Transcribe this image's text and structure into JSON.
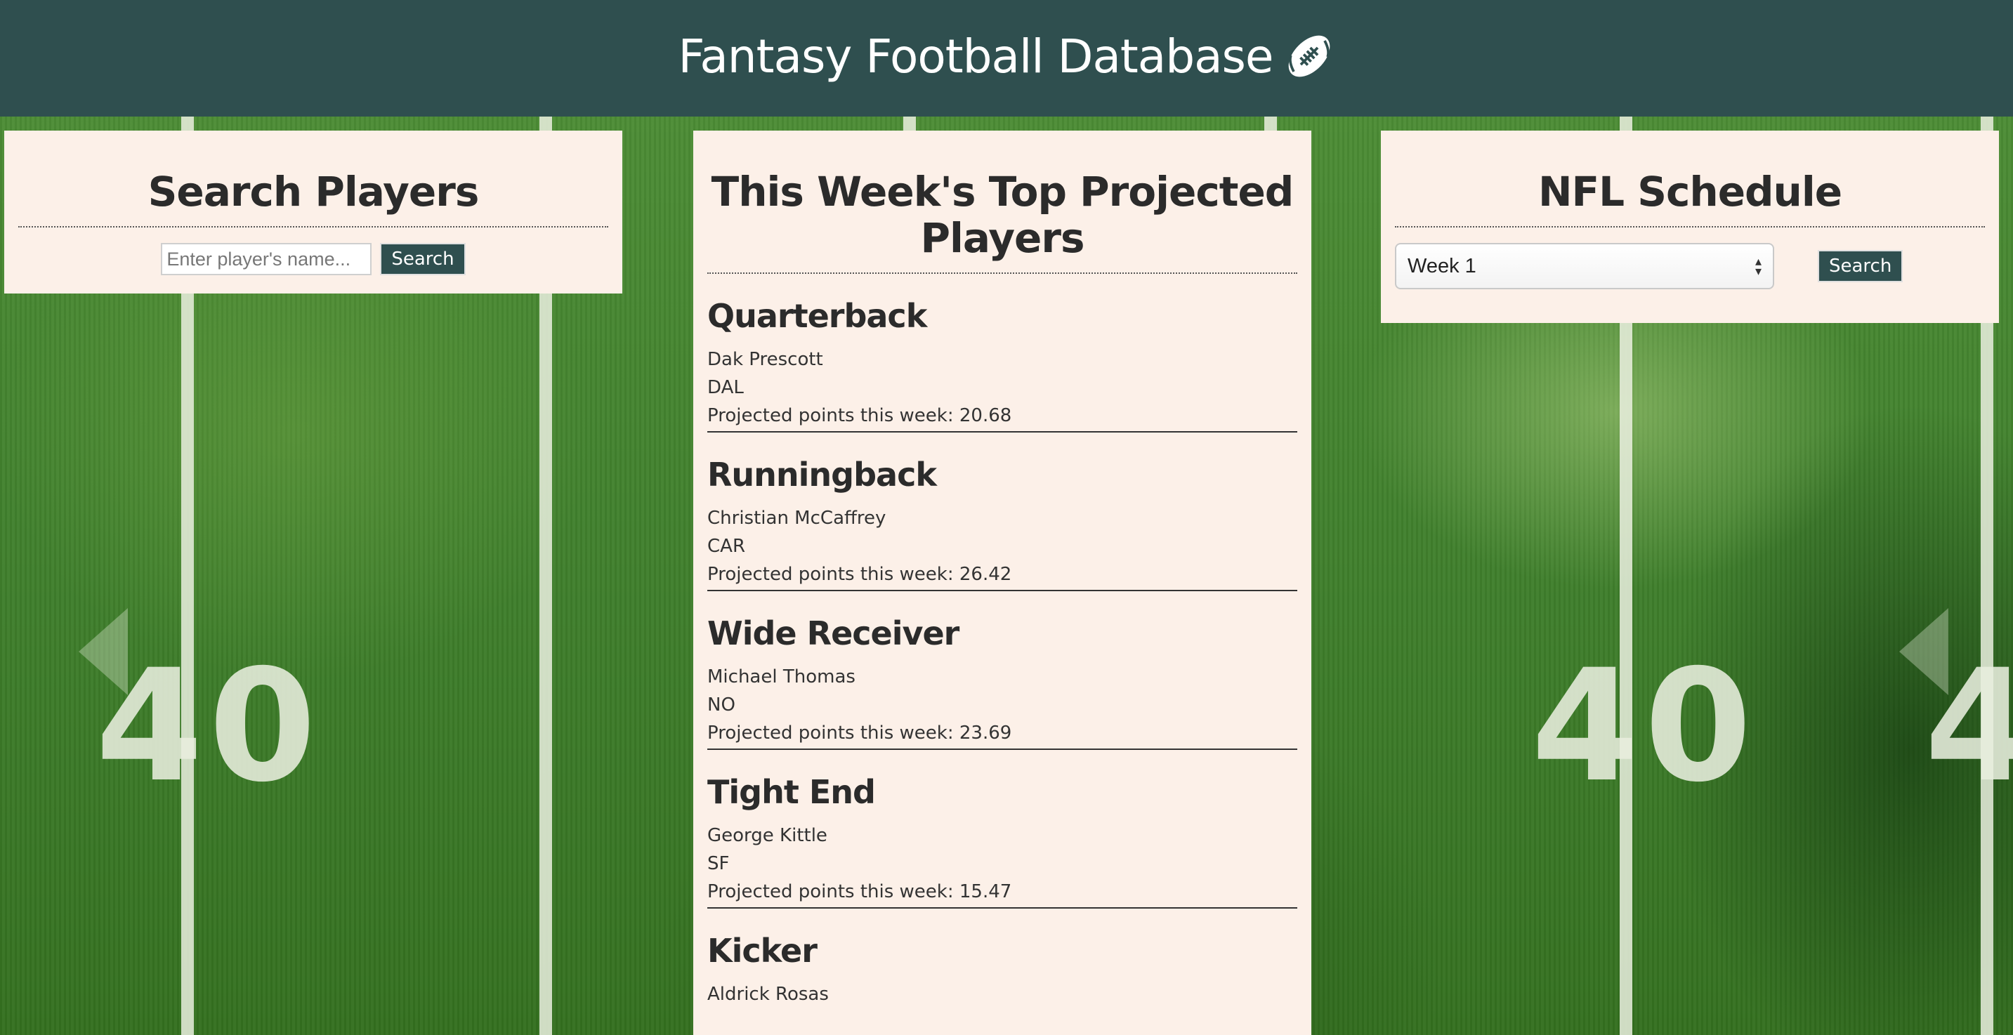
{
  "header": {
    "title": "Fantasy Football Database"
  },
  "search_panel": {
    "title": "Search Players",
    "input_placeholder": "Enter player's name...",
    "button_label": "Search"
  },
  "projections_panel": {
    "title": "This Week's Top Projected Players",
    "positions": [
      {
        "position": "Quarterback",
        "player": "Dak Prescott",
        "team": "DAL",
        "points_text": "Projected points this week: 20.68"
      },
      {
        "position": "Runningback",
        "player": "Christian McCaffrey",
        "team": "CAR",
        "points_text": "Projected points this week: 26.42"
      },
      {
        "position": "Wide Receiver",
        "player": "Michael Thomas",
        "team": "NO",
        "points_text": "Projected points this week: 23.69"
      },
      {
        "position": "Tight End",
        "player": "George Kittle",
        "team": "SF",
        "points_text": "Projected points this week: 15.47"
      },
      {
        "position": "Kicker",
        "player": "Aldrick Rosas",
        "team": "",
        "points_text": ""
      }
    ]
  },
  "schedule_panel": {
    "title": "NFL Schedule",
    "selected_week": "Week 1",
    "button_label": "Search"
  },
  "background": {
    "yard_numbers": [
      "40",
      "40",
      "4"
    ]
  },
  "colors": {
    "header_bg": "#2f4f4f",
    "panel_bg": "#fcf0e8",
    "button_bg": "#2f4f4f"
  }
}
